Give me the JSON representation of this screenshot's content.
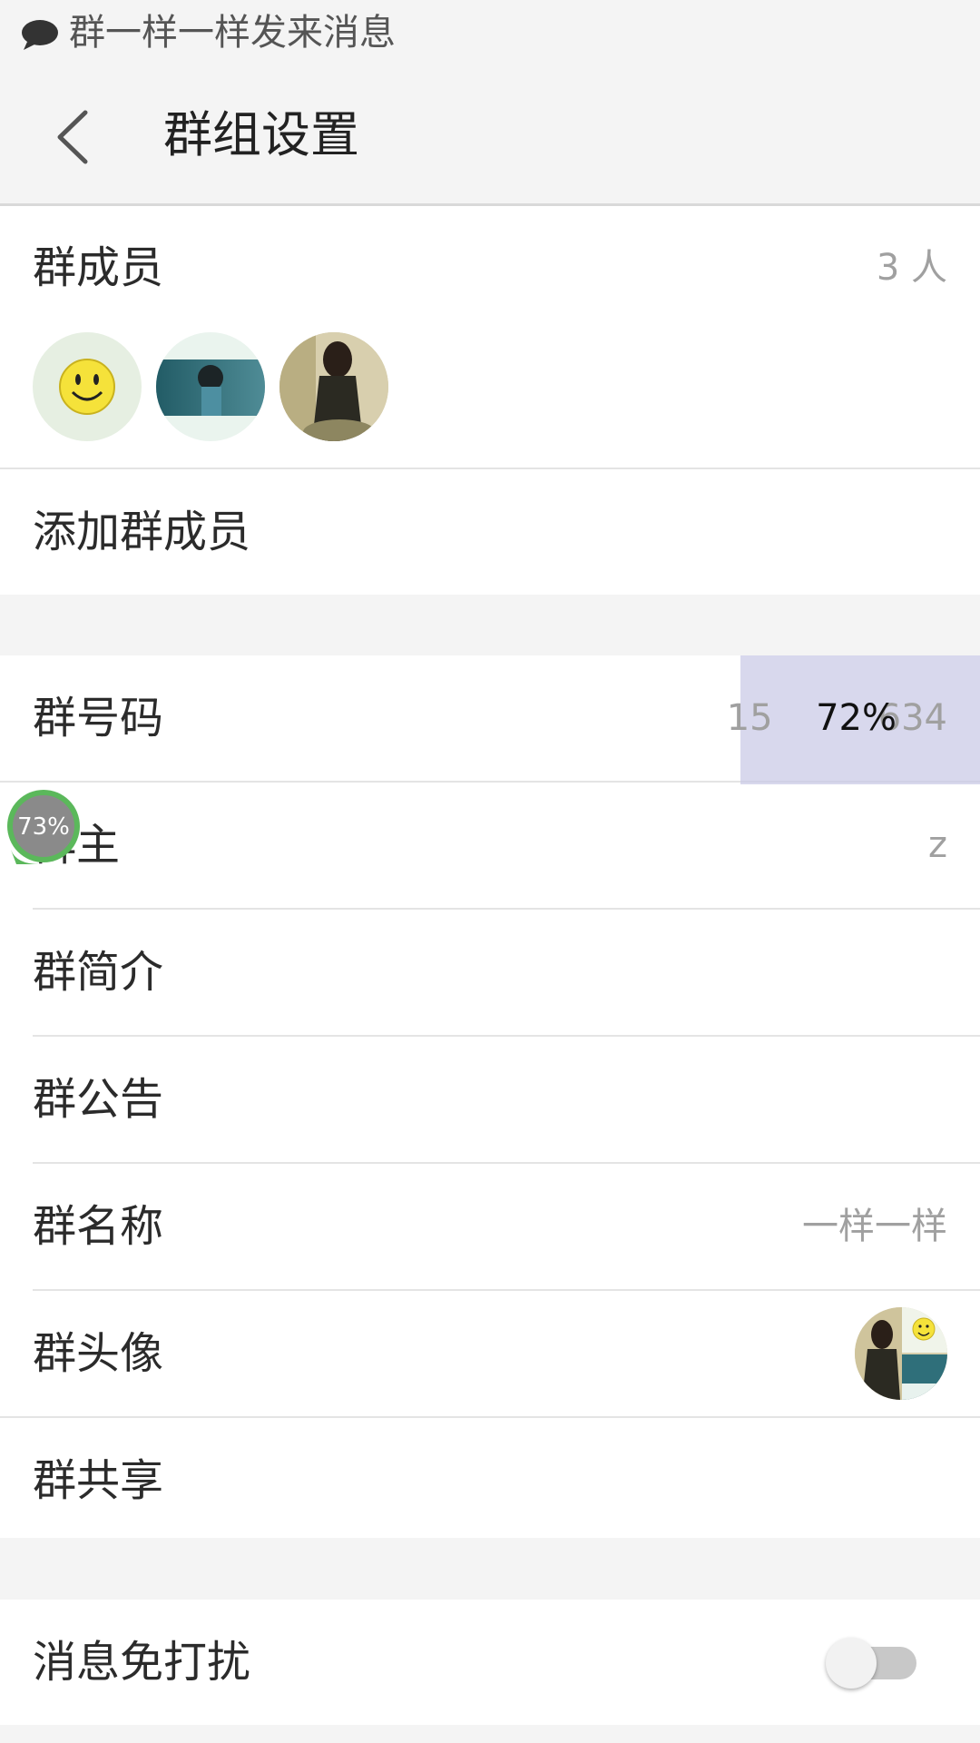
{
  "notification": {
    "icon": "chat-bubble-icon",
    "text": "群一样一样发来消息"
  },
  "header": {
    "title": "群组设置",
    "back_icon": "chevron-left-icon"
  },
  "members": {
    "label": "群成员",
    "count": "3 人",
    "avatars": [
      "smiley-avatar",
      "photo-avatar-teal",
      "photo-avatar-woman"
    ]
  },
  "add_member": {
    "label": "添加群成员"
  },
  "info": {
    "group_number": {
      "label": "群号码",
      "value": "15",
      "value_tail": "634",
      "overlay_percent": "72%"
    },
    "owner": {
      "label": "群主",
      "value": "z"
    },
    "intro": {
      "label": "群简介"
    },
    "announcement": {
      "label": "群公告"
    },
    "name": {
      "label": "群名称",
      "value": "一样一样"
    },
    "avatar": {
      "label": "群头像"
    },
    "share": {
      "label": "群共享"
    }
  },
  "dnd": {
    "label": "消息免打扰",
    "enabled": false
  },
  "floating_ball": {
    "percent": "73%"
  },
  "colors": {
    "background": "#f4f4f4",
    "highlight": "#c8c8e6",
    "accent_green": "#5bb85b"
  }
}
